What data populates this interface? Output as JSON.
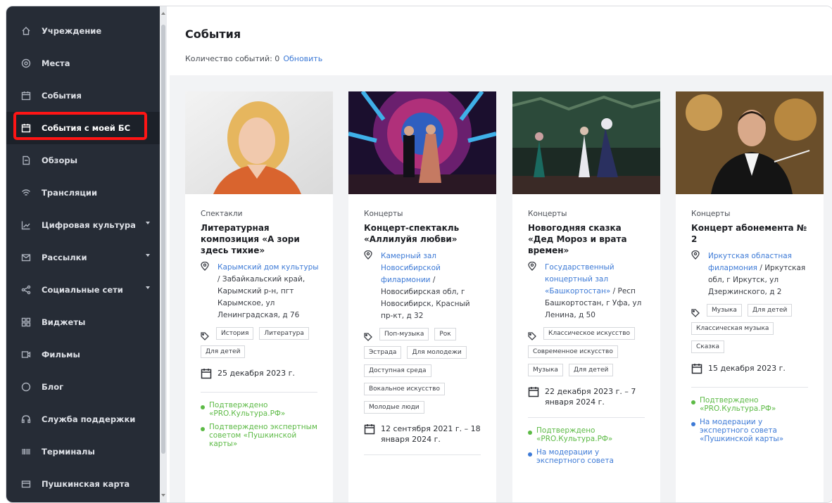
{
  "sidebar": {
    "items": [
      {
        "label": "Учреждение",
        "icon": "home-icon"
      },
      {
        "label": "Места",
        "icon": "location-icon"
      },
      {
        "label": "События",
        "icon": "calendar-icon"
      },
      {
        "label": "События с моей БС",
        "icon": "calendar-icon"
      },
      {
        "label": "Обзоры",
        "icon": "document-icon"
      },
      {
        "label": "Трансляции",
        "icon": "wifi-icon"
      },
      {
        "label": "Цифровая культура",
        "icon": "chart-icon"
      },
      {
        "label": "Рассылки",
        "icon": "mail-icon"
      },
      {
        "label": "Социальные сети",
        "icon": "share-icon"
      },
      {
        "label": "Виджеты",
        "icon": "grid-icon"
      },
      {
        "label": "Фильмы",
        "icon": "film-icon"
      },
      {
        "label": "Блог",
        "icon": "chat-icon"
      },
      {
        "label": "Служба поддержки",
        "icon": "headset-icon"
      },
      {
        "label": "Терминалы",
        "icon": "barcode-icon"
      },
      {
        "label": "Пушкинская карта",
        "icon": "card-icon"
      }
    ]
  },
  "header": {
    "title": "События",
    "count_label": "Количество событий: 0",
    "refresh_label": "Обновить"
  },
  "cards": [
    {
      "category": "Спектакли",
      "title": "Литературная композиция «А зори здесь тихие»",
      "place_link": "Карымский дом культуры",
      "place_text": "/ Забайкальский край, Карымский р-н, пгт Карымское, ул Ленинградская, д 76",
      "tags": [
        "История",
        "Литература",
        "Для детей"
      ],
      "date": "25 декабря 2023 г.",
      "statuses": [
        {
          "text": "Подтверждено «PRO.Культура.РФ»",
          "kind": "green"
        },
        {
          "text": "Подтверждено экспертным советом «Пушкинской карты»",
          "kind": "green"
        }
      ]
    },
    {
      "category": "Концерты",
      "title": "Концерт-спектакль «Аллилуйя любви»",
      "place_link": "Камерный зал Новосибирской филармонии",
      "place_text": "/ Новосибирская обл, г Новосибирск, Красный пр-кт, д 32",
      "tags": [
        "Поп-музыка",
        "Рок",
        "Эстрада",
        "Для молодежи",
        "Доступная среда",
        "Вокальное искусство",
        "Молодые люди"
      ],
      "date": "12 сентября 2021 г. – 18 января 2024 г.",
      "statuses": []
    },
    {
      "category": "Концерты",
      "title": "Новогодняя сказка «Дед Мороз и врата времен»",
      "place_link": "Государственный концертный зал «Башкортостан»",
      "place_text": "/ Респ Башкортостан, г Уфа, ул Ленина, д 50",
      "tags": [
        "Классическое искусство",
        "Современное искусство",
        "Музыка",
        "Для детей"
      ],
      "date": "22 декабря 2023 г. – 7 января 2024 г.",
      "statuses": [
        {
          "text": "Подтверждено «PRO.Культура.РФ»",
          "kind": "green"
        },
        {
          "text": "На модерации у экспертного совета",
          "kind": "blue"
        }
      ]
    },
    {
      "category": "Концерты",
      "title": "Концерт абонемента № 2",
      "place_link": "Иркутская областная филармония",
      "place_text": "/ Иркутская обл, г Иркутск, ул Дзержинского, д 2",
      "tags": [
        "Музыка",
        "Для детей",
        "Классическая музыка",
        "Сказка"
      ],
      "date": "15 декабря 2023 г.",
      "statuses": [
        {
          "text": "Подтверждено «PRO.Культура.РФ»",
          "kind": "green"
        },
        {
          "text": "На модерации у экспертного совета «Пушкинской карты»",
          "kind": "blue"
        }
      ]
    }
  ],
  "colors": {
    "sidebar_bg": "#262c36",
    "highlight": "#ff1515",
    "link": "#3d7ad6",
    "confirmed": "#5cba45"
  }
}
